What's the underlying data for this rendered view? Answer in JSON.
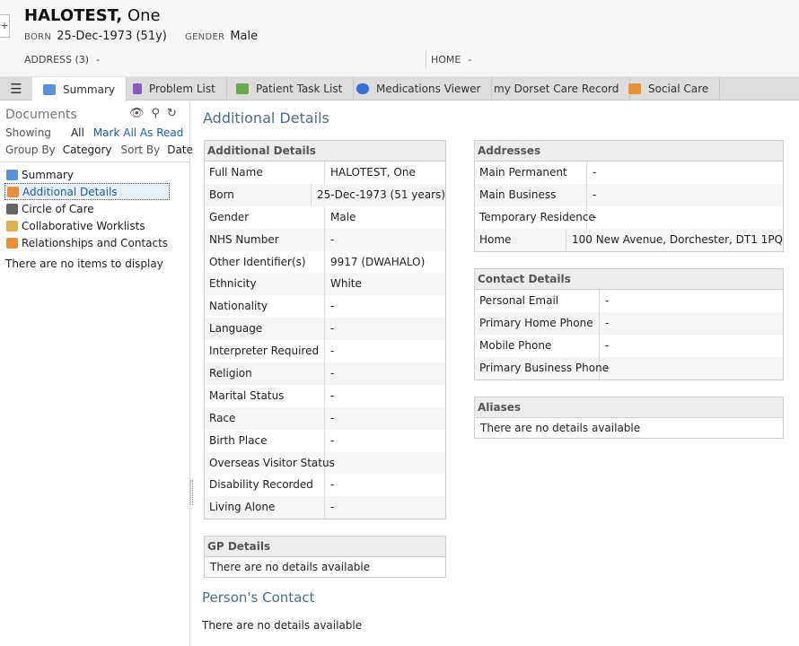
{
  "header": {
    "surname": "HALOTEST,",
    "forename": "One",
    "born_label": "BORN",
    "born_value": "25-Dec-1973 (51y)",
    "gender_label": "GENDER",
    "gender_value": "Male",
    "address_label": "ADDRESS (3)",
    "address_value": "-",
    "home_label": "HOME",
    "home_value": "-",
    "expand_glyph": "+"
  },
  "tabs": [
    {
      "label": "Summary",
      "icon": "summary-icon",
      "color": "#5b8fd6"
    },
    {
      "label": "Problem List",
      "icon": "clipboard-icon",
      "color": "#8a5bbf"
    },
    {
      "label": "Patient Task List",
      "icon": "notepad-icon",
      "color": "#6aa84f"
    },
    {
      "label": "Medications Viewer",
      "icon": "pill-icon",
      "color": "#3a6fd6"
    },
    {
      "label": "my Dorset Care Record",
      "icon": "",
      "color": ""
    },
    {
      "label": "Social Care",
      "icon": "people-icon",
      "color": "#e69138"
    }
  ],
  "documents": {
    "title": "Documents",
    "showing_label": "Showing",
    "showing_value": "All",
    "mark_all": "Mark All As Read",
    "group_label": "Group By",
    "group_value": "Category",
    "sort_label": "Sort By",
    "sort_value": "Date",
    "tree": [
      {
        "label": "Summary",
        "icon": "summary-icon",
        "color": "#5b8fd6",
        "selected": false
      },
      {
        "label": "Additional Details",
        "icon": "people-icon",
        "color": "#e69138",
        "selected": true
      },
      {
        "label": "Circle of Care",
        "icon": "group-icon",
        "color": "#666666",
        "selected": false
      },
      {
        "label": "Collaborative Worklists",
        "icon": "folder-icon",
        "color": "#d9b24a",
        "selected": false
      },
      {
        "label": "Relationships and Contacts",
        "icon": "people-icon",
        "color": "#e69138",
        "selected": false
      }
    ],
    "empty_message": "There are no items to display"
  },
  "main": {
    "title": "Additional Details",
    "additional": {
      "heading": "Additional Details",
      "rows": [
        {
          "k": "Full Name",
          "v": "HALOTEST, One"
        },
        {
          "k": "Born",
          "v": "25-Dec-1973 (51 years)"
        },
        {
          "k": "Gender",
          "v": "Male"
        },
        {
          "k": "NHS Number",
          "v": "-"
        },
        {
          "k": "Other Identifier(s)",
          "v": "9917 (DWAHALO)"
        },
        {
          "k": "Ethnicity",
          "v": "White"
        },
        {
          "k": "Nationality",
          "v": "-"
        },
        {
          "k": "Language",
          "v": "-"
        },
        {
          "k": "Interpreter Required",
          "v": "-"
        },
        {
          "k": "Religion",
          "v": "-"
        },
        {
          "k": "Marital Status",
          "v": "-"
        },
        {
          "k": "Race",
          "v": "-"
        },
        {
          "k": "Birth Place",
          "v": "-"
        },
        {
          "k": "Overseas Visitor Status",
          "v": "-"
        },
        {
          "k": "Disability Recorded",
          "v": "-"
        },
        {
          "k": "Living Alone",
          "v": "-"
        }
      ]
    },
    "gp": {
      "heading": "GP Details",
      "empty": "There are no details available"
    },
    "addresses": {
      "heading": "Addresses",
      "rows": [
        {
          "k": "Main Permanent",
          "v": "-"
        },
        {
          "k": "Main Business",
          "v": "-"
        },
        {
          "k": "Temporary Residence",
          "v": "-"
        },
        {
          "k": "Home",
          "v": "100 New Avenue, Dorchester, DT1 1PQ"
        }
      ]
    },
    "contact": {
      "heading": "Contact Details",
      "rows": [
        {
          "k": "Personal Email",
          "v": "-"
        },
        {
          "k": "Primary Home Phone",
          "v": "-"
        },
        {
          "k": "Mobile Phone",
          "v": "-"
        },
        {
          "k": "Primary Business Phone",
          "v": "-"
        }
      ]
    },
    "aliases": {
      "heading": "Aliases",
      "empty": "There are no details available"
    },
    "persons_contact": {
      "heading": "Person's Contact",
      "empty": "There are no details available"
    }
  }
}
